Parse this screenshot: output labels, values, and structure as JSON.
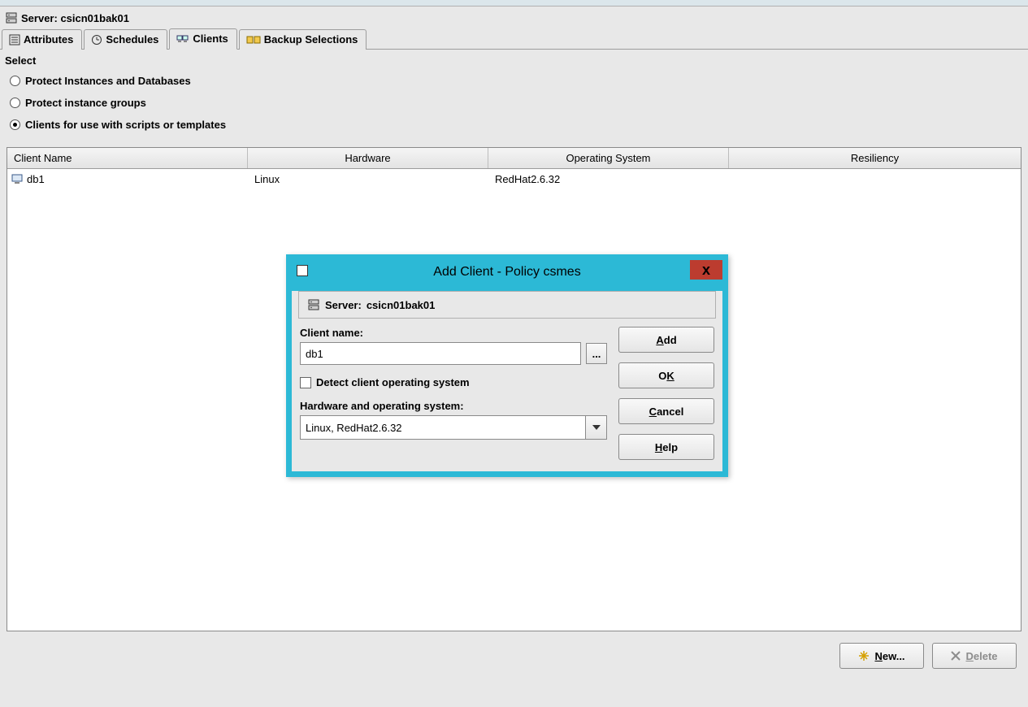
{
  "header": {
    "server_prefix": "Server:",
    "server_name": "csicn01bak01"
  },
  "tabs": {
    "attributes": "Attributes",
    "schedules": "Schedules",
    "clients": "Clients",
    "backup_selections": "Backup Selections"
  },
  "select_section": {
    "label": "Select",
    "opt1": "Protect Instances and Databases",
    "opt2": "Protect instance groups",
    "opt3": "Clients for use with scripts or templates"
  },
  "table": {
    "headers": {
      "client_name": "Client Name",
      "hardware": "Hardware",
      "os": "Operating System",
      "resiliency": "Resiliency"
    },
    "rows": [
      {
        "client": "db1",
        "hardware": "Linux",
        "os": "RedHat2.6.32",
        "resiliency": ""
      }
    ]
  },
  "footer": {
    "new": "New...",
    "delete": "Delete"
  },
  "dialog": {
    "title": "Add Client - Policy csmes",
    "server_prefix": "Server:",
    "server_name": "csicn01bak01",
    "client_name_label": "Client name:",
    "client_name_value": "db1",
    "browse": "...",
    "detect_label": "Detect client operating system",
    "hw_os_label": "Hardware and operating system:",
    "hw_os_value": "Linux, RedHat2.6.32",
    "buttons": {
      "add": "Add",
      "ok": "OK",
      "cancel": "Cancel",
      "help": "Help"
    }
  }
}
